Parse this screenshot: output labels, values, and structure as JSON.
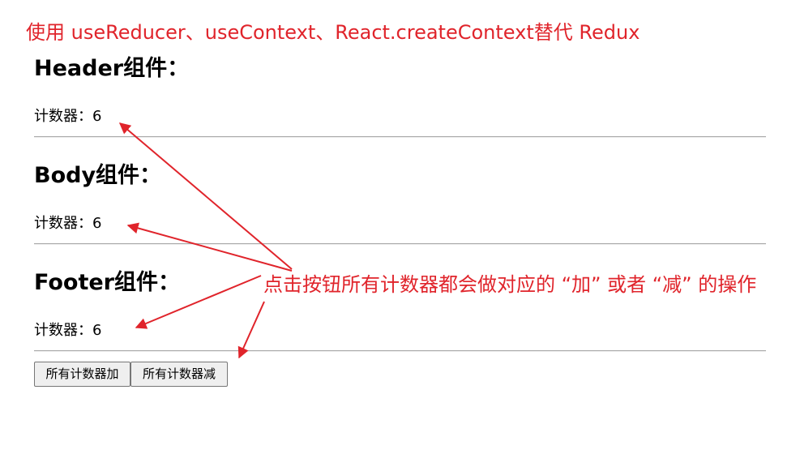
{
  "intro_note": "使用 useReducer、useContext、React.createContext替代 Redux",
  "sections": [
    {
      "title": "Header组件：",
      "counter_label": "计数器：",
      "counter_value": "6"
    },
    {
      "title": "Body组件：",
      "counter_label": "计数器：",
      "counter_value": "6"
    },
    {
      "title": "Footer组件：",
      "counter_label": "计数器：",
      "counter_value": "6"
    }
  ],
  "buttons": {
    "increment_label": "所有计数器加",
    "decrement_label": "所有计数器减"
  },
  "annotation": {
    "text": "点击按钮所有计数器都会做对应的 “加” 或者 “减” 的操作",
    "color": "#e0242b"
  }
}
